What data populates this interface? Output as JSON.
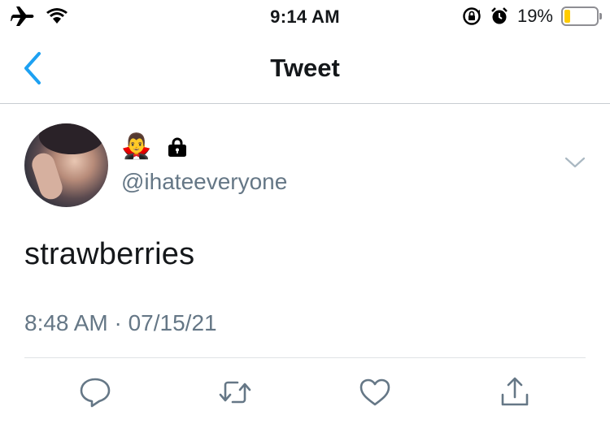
{
  "status_bar": {
    "time": "9:14 AM",
    "battery_percent_text": "19%",
    "battery_level": 0.19,
    "icons": [
      "airplane-icon",
      "wifi-icon",
      "orientation-lock-icon",
      "alarm-icon",
      "battery-icon"
    ]
  },
  "nav": {
    "title": "Tweet",
    "back_icon": "chevron-left-icon"
  },
  "tweet": {
    "display_name_emoji": "🧛‍♂️",
    "protected_icon": "lock-icon",
    "handle": "@ihateeveryone",
    "text": "strawberries",
    "timestamp": "8:48 AM · 07/15/21",
    "menu_icon": "chevron-down-icon"
  },
  "actions": {
    "icons": [
      "reply-icon",
      "retweet-icon",
      "like-icon",
      "share-icon"
    ]
  },
  "colors": {
    "accent": "#1da1f2",
    "secondary_text": "#657786",
    "battery_fill": "#ffcc00"
  }
}
